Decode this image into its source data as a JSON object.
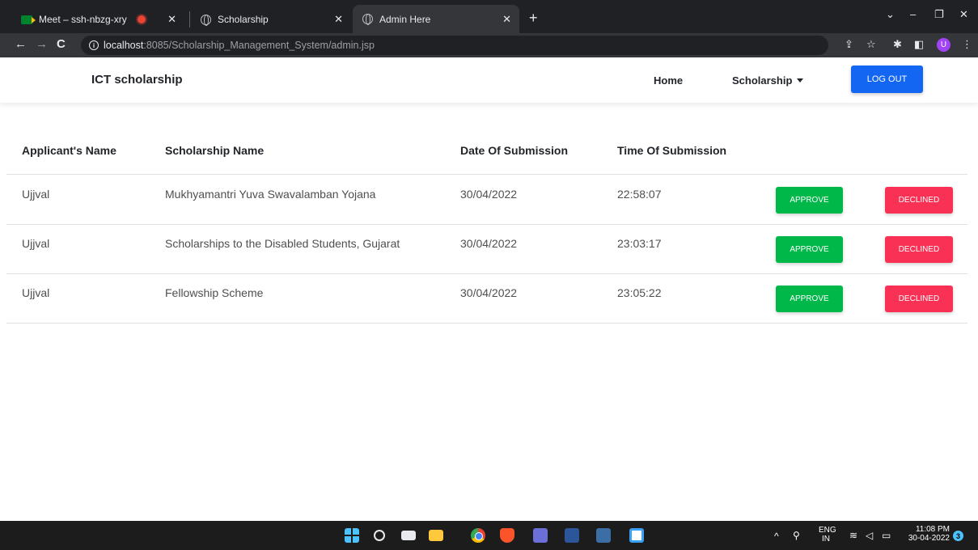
{
  "browser": {
    "tabs": [
      {
        "title": "Meet – ssh-nbzg-xry",
        "icon": "google-meet-icon"
      },
      {
        "title": "",
        "icon": "recording-icon"
      },
      {
        "title": "Scholarship",
        "icon": "globe-icon"
      },
      {
        "title": "Admin Here",
        "icon": "globe-icon",
        "active": true
      }
    ],
    "url_host": "localhost",
    "url_rest": ":8085/Scholarship_Management_System/admin.jsp",
    "profile_initial": "U"
  },
  "navbar": {
    "brand": "ICT scholarship",
    "home": "Home",
    "scholarship": "Scholarship",
    "logout": "LOG OUT"
  },
  "table": {
    "headers": [
      "Applicant's Name",
      "Scholarship Name",
      "Date Of Submission",
      "Time Of Submission"
    ],
    "rows": [
      {
        "name": "Ujjval",
        "scholarship": "Mukhyamantri Yuva Swavalamban Yojana",
        "date": "30/04/2022",
        "time": "22:58:07"
      },
      {
        "name": "Ujjval",
        "scholarship": "Scholarships to the Disabled Students, Gujarat",
        "date": "30/04/2022",
        "time": "23:03:17"
      },
      {
        "name": "Ujjval",
        "scholarship": "Fellowship Scheme",
        "date": "30/04/2022",
        "time": "23:05:22"
      }
    ],
    "approve_label": "APPROVE",
    "decline_label": "DECLINED"
  },
  "taskbar": {
    "lang_top": "ENG",
    "lang_bottom": "IN",
    "time": "11:08 PM",
    "date": "30-04-2022",
    "notifications": "3"
  },
  "colors": {
    "primary": "#1266f1",
    "success": "#00b74a",
    "danger": "#f93154"
  }
}
